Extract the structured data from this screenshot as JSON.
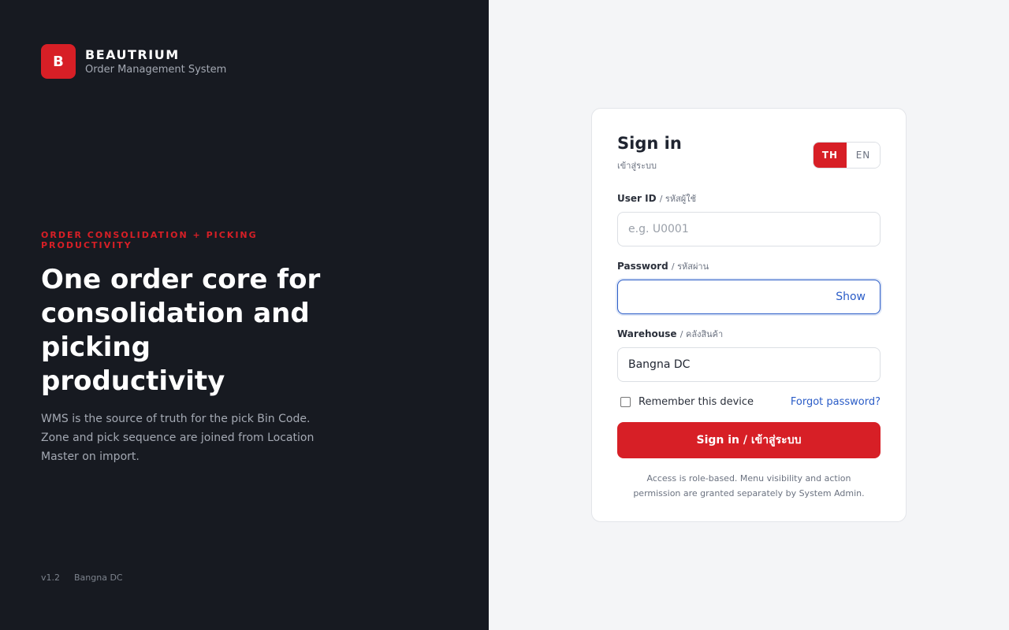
{
  "brand": {
    "logo_letter": "B",
    "name": "BEAUTRIUM",
    "subtitle": "Order Management System"
  },
  "hero": {
    "kicker": "ORDER CONSOLIDATION + PICKING PRODUCTIVITY",
    "headline": "One order core for consolidation and picking productivity",
    "description": "WMS is the source of truth for the pick Bin Code. Zone and pick sequence are joined from Location Master on import."
  },
  "footer": {
    "version": "v1.2",
    "warehouse": "Bangna DC"
  },
  "login": {
    "title": "Sign in",
    "subtitle": "เข้าสู่ระบบ",
    "language": {
      "options": [
        "TH",
        "EN"
      ],
      "selected": "TH"
    },
    "user_id": {
      "label": "User ID",
      "label_th": "/ รหัสผู้ใช้",
      "value": "",
      "placeholder": "e.g. U0001"
    },
    "password": {
      "label": "Password",
      "label_th": "/ รหัสผ่าน",
      "value": "",
      "toggle_label": "Show"
    },
    "warehouse": {
      "label": "Warehouse",
      "label_th": "/ คลังสินค้า",
      "value": "Bangna DC"
    },
    "remember_label": "Remember this device",
    "remember_checked": false,
    "forgot_label": "Forgot password?",
    "submit_label": "Sign in / เข้าสู่ระบบ",
    "note": "Access is role-based. Menu visibility and action permission are granted separately by System Admin."
  },
  "colors": {
    "accent": "#d71f26",
    "link": "#2a5cc7",
    "sidebar_bg": "#171a21"
  }
}
